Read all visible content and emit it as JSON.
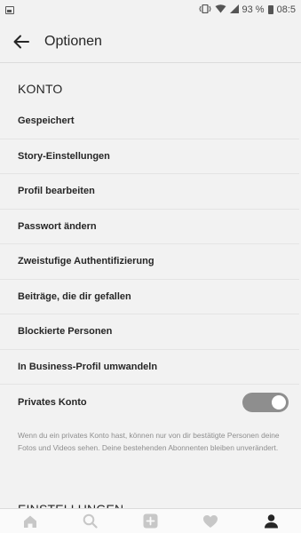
{
  "status_bar": {
    "battery": "93 %",
    "time": "08:5"
  },
  "app_bar": {
    "title": "Optionen"
  },
  "sections": {
    "account": {
      "header": "KONTO",
      "items": [
        "Gespeichert",
        "Story-Einstellungen",
        "Profil bearbeiten",
        "Passwort ändern",
        "Zweistufige Authentifizierung",
        "Beiträge, die dir gefallen",
        "Blockierte Personen",
        "In Business-Profil umwandeln"
      ],
      "private_account": {
        "label": "Privates Konto",
        "enabled": true
      },
      "private_hint": "Wenn du ein privates Konto hast, können nur von dir bestätigte Personen deine Fotos und Videos sehen. Deine bestehenden Abonnenten bleiben unverändert."
    },
    "settings": {
      "header": "EINSTELLUNGEN"
    }
  },
  "colors": {
    "background": "#f2f2f2",
    "text": "#262626",
    "muted": "#8e8e8e",
    "toggle_track": "#8e8e8e",
    "icon_muted": "#c7c7c7"
  },
  "bottom_nav": {
    "icons": [
      "home-icon",
      "search-icon",
      "add-post-icon",
      "heart-icon",
      "profile-icon"
    ],
    "active": "profile-icon"
  }
}
